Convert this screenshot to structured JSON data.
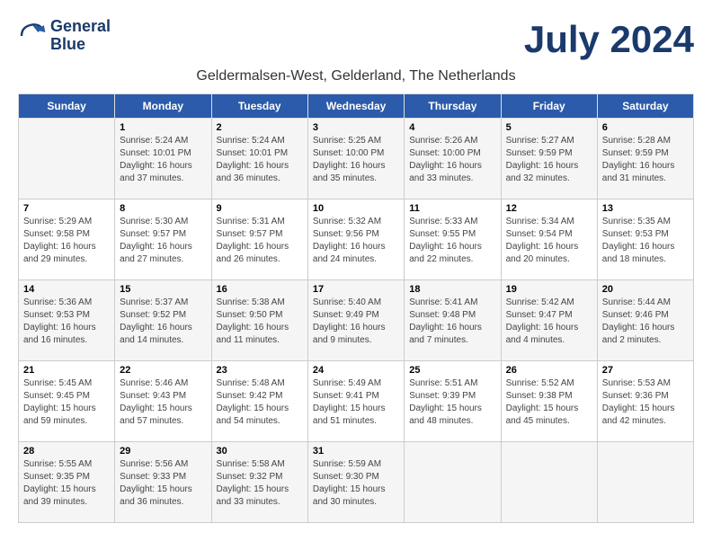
{
  "logo": {
    "line1": "General",
    "line2": "Blue"
  },
  "title": "July 2024",
  "subtitle": "Geldermalsen-West, Gelderland, The Netherlands",
  "days_of_week": [
    "Sunday",
    "Monday",
    "Tuesday",
    "Wednesday",
    "Thursday",
    "Friday",
    "Saturday"
  ],
  "weeks": [
    [
      {
        "day": "",
        "info": ""
      },
      {
        "day": "1",
        "info": "Sunrise: 5:24 AM\nSunset: 10:01 PM\nDaylight: 16 hours\nand 37 minutes."
      },
      {
        "day": "2",
        "info": "Sunrise: 5:24 AM\nSunset: 10:01 PM\nDaylight: 16 hours\nand 36 minutes."
      },
      {
        "day": "3",
        "info": "Sunrise: 5:25 AM\nSunset: 10:00 PM\nDaylight: 16 hours\nand 35 minutes."
      },
      {
        "day": "4",
        "info": "Sunrise: 5:26 AM\nSunset: 10:00 PM\nDaylight: 16 hours\nand 33 minutes."
      },
      {
        "day": "5",
        "info": "Sunrise: 5:27 AM\nSunset: 9:59 PM\nDaylight: 16 hours\nand 32 minutes."
      },
      {
        "day": "6",
        "info": "Sunrise: 5:28 AM\nSunset: 9:59 PM\nDaylight: 16 hours\nand 31 minutes."
      }
    ],
    [
      {
        "day": "7",
        "info": "Sunrise: 5:29 AM\nSunset: 9:58 PM\nDaylight: 16 hours\nand 29 minutes."
      },
      {
        "day": "8",
        "info": "Sunrise: 5:30 AM\nSunset: 9:57 PM\nDaylight: 16 hours\nand 27 minutes."
      },
      {
        "day": "9",
        "info": "Sunrise: 5:31 AM\nSunset: 9:57 PM\nDaylight: 16 hours\nand 26 minutes."
      },
      {
        "day": "10",
        "info": "Sunrise: 5:32 AM\nSunset: 9:56 PM\nDaylight: 16 hours\nand 24 minutes."
      },
      {
        "day": "11",
        "info": "Sunrise: 5:33 AM\nSunset: 9:55 PM\nDaylight: 16 hours\nand 22 minutes."
      },
      {
        "day": "12",
        "info": "Sunrise: 5:34 AM\nSunset: 9:54 PM\nDaylight: 16 hours\nand 20 minutes."
      },
      {
        "day": "13",
        "info": "Sunrise: 5:35 AM\nSunset: 9:53 PM\nDaylight: 16 hours\nand 18 minutes."
      }
    ],
    [
      {
        "day": "14",
        "info": "Sunrise: 5:36 AM\nSunset: 9:53 PM\nDaylight: 16 hours\nand 16 minutes."
      },
      {
        "day": "15",
        "info": "Sunrise: 5:37 AM\nSunset: 9:52 PM\nDaylight: 16 hours\nand 14 minutes."
      },
      {
        "day": "16",
        "info": "Sunrise: 5:38 AM\nSunset: 9:50 PM\nDaylight: 16 hours\nand 11 minutes."
      },
      {
        "day": "17",
        "info": "Sunrise: 5:40 AM\nSunset: 9:49 PM\nDaylight: 16 hours\nand 9 minutes."
      },
      {
        "day": "18",
        "info": "Sunrise: 5:41 AM\nSunset: 9:48 PM\nDaylight: 16 hours\nand 7 minutes."
      },
      {
        "day": "19",
        "info": "Sunrise: 5:42 AM\nSunset: 9:47 PM\nDaylight: 16 hours\nand 4 minutes."
      },
      {
        "day": "20",
        "info": "Sunrise: 5:44 AM\nSunset: 9:46 PM\nDaylight: 16 hours\nand 2 minutes."
      }
    ],
    [
      {
        "day": "21",
        "info": "Sunrise: 5:45 AM\nSunset: 9:45 PM\nDaylight: 15 hours\nand 59 minutes."
      },
      {
        "day": "22",
        "info": "Sunrise: 5:46 AM\nSunset: 9:43 PM\nDaylight: 15 hours\nand 57 minutes."
      },
      {
        "day": "23",
        "info": "Sunrise: 5:48 AM\nSunset: 9:42 PM\nDaylight: 15 hours\nand 54 minutes."
      },
      {
        "day": "24",
        "info": "Sunrise: 5:49 AM\nSunset: 9:41 PM\nDaylight: 15 hours\nand 51 minutes."
      },
      {
        "day": "25",
        "info": "Sunrise: 5:51 AM\nSunset: 9:39 PM\nDaylight: 15 hours\nand 48 minutes."
      },
      {
        "day": "26",
        "info": "Sunrise: 5:52 AM\nSunset: 9:38 PM\nDaylight: 15 hours\nand 45 minutes."
      },
      {
        "day": "27",
        "info": "Sunrise: 5:53 AM\nSunset: 9:36 PM\nDaylight: 15 hours\nand 42 minutes."
      }
    ],
    [
      {
        "day": "28",
        "info": "Sunrise: 5:55 AM\nSunset: 9:35 PM\nDaylight: 15 hours\nand 39 minutes."
      },
      {
        "day": "29",
        "info": "Sunrise: 5:56 AM\nSunset: 9:33 PM\nDaylight: 15 hours\nand 36 minutes."
      },
      {
        "day": "30",
        "info": "Sunrise: 5:58 AM\nSunset: 9:32 PM\nDaylight: 15 hours\nand 33 minutes."
      },
      {
        "day": "31",
        "info": "Sunrise: 5:59 AM\nSunset: 9:30 PM\nDaylight: 15 hours\nand 30 minutes."
      },
      {
        "day": "",
        "info": ""
      },
      {
        "day": "",
        "info": ""
      },
      {
        "day": "",
        "info": ""
      }
    ]
  ]
}
